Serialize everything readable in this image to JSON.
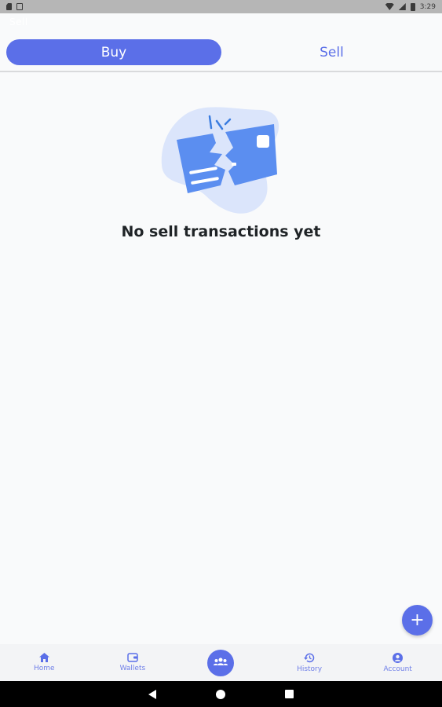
{
  "status_bar": {
    "time": "3:29",
    "icons": [
      "sd-card-icon",
      "download-icon",
      "wifi-icon",
      "signal-icon",
      "battery-icon"
    ]
  },
  "toolbar": {
    "title": "Sell"
  },
  "tabs": [
    {
      "label": "Buy",
      "selected": true
    },
    {
      "label": "Sell",
      "selected": false
    }
  ],
  "empty_state": {
    "icon": "broken-card-illustration",
    "message": "No sell transactions yet"
  },
  "fab": {
    "label": "+",
    "icon": "plus-icon"
  },
  "bottom_nav": {
    "items": [
      {
        "label": "Home",
        "icon": "home-icon"
      },
      {
        "label": "Wallets",
        "icon": "wallet-icon"
      },
      {
        "label": "",
        "icon": "people-icon"
      },
      {
        "label": "History",
        "icon": "history-icon"
      },
      {
        "label": "Account",
        "icon": "account-icon"
      }
    ]
  },
  "colors": {
    "accent": "#5b6fe8",
    "background": "#f9fafb",
    "text": "#1f2326"
  }
}
